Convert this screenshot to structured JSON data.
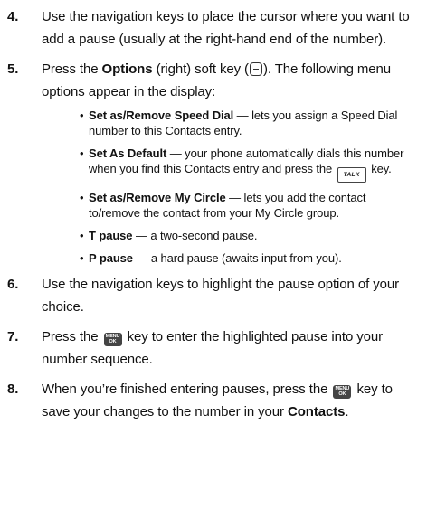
{
  "steps": [
    {
      "number": "4.",
      "text": "Use the navigation keys to place the cursor where you want to add a pause (usually at the right-hand end of the number)."
    },
    {
      "number": "5.",
      "text_a": "Press the ",
      "bold_a": "Options",
      "text_b": " (right) soft key (",
      "text_c": "). The following menu options appear in the display:",
      "bullets": [
        {
          "bold": "Set as/Remove Speed Dial",
          "text": " — lets you assign a Speed Dial number to this Contacts entry."
        },
        {
          "bold": "Set As Default",
          "text_a": " — your phone automatically dials this number when you find this Contacts entry and press the ",
          "text_b": " key."
        },
        {
          "bold": "Set as/Remove My Circle",
          "text": " — lets you add the contact to/remove the contact from your My Circle group."
        },
        {
          "bold": "T pause",
          "text": " — a two-second pause."
        },
        {
          "bold": "P pause",
          "text": " — a hard pause (awaits input from you)."
        }
      ]
    },
    {
      "number": "6.",
      "text": "Use the navigation keys to highlight the pause option of your choice."
    },
    {
      "number": "7.",
      "text_a": "Press the ",
      "text_b": " key to enter the highlighted pause into your number sequence."
    },
    {
      "number": "8.",
      "text_a": "When you’re finished entering pauses, press the ",
      "text_b": " key to save your changes to the number in your ",
      "bold_a": "Contacts",
      "text_c": "."
    }
  ],
  "icons": {
    "talk_key_label": "TALK",
    "menu_key_line1": "MENU",
    "menu_key_line2": "OK"
  }
}
